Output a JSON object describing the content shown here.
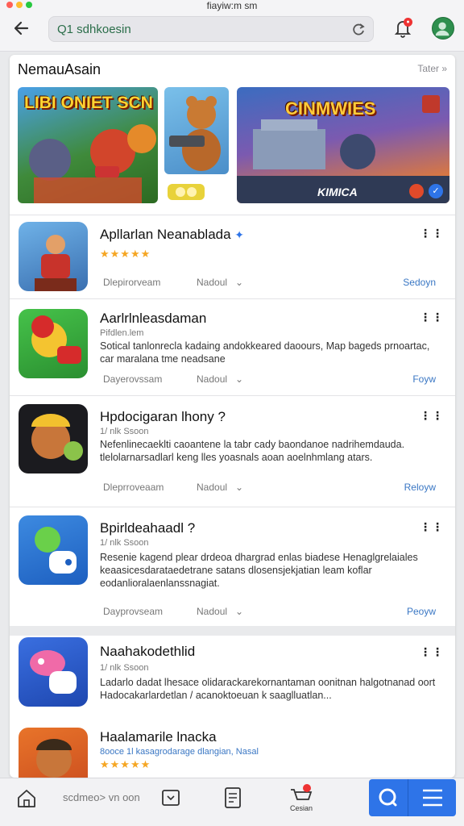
{
  "window": {
    "title": "fiayiw:m sm"
  },
  "search": {
    "value": "Q1 sdhkoesin"
  },
  "section": {
    "title": "NemauAsain",
    "see_all": "Tater »"
  },
  "banners": [
    {
      "text": "LIBI ONIET SCN",
      "tag": ""
    },
    {
      "text": "",
      "tag": ""
    },
    {
      "text": "CINMWIES",
      "tag": "KIMICA"
    }
  ],
  "apps": [
    {
      "name": "Apllarlan Neanablada",
      "stars": "★★★★★",
      "meta": "",
      "description": "",
      "left_label": "Dlepirorveam",
      "mid_label": "Nadoul",
      "action": "Sedoyn"
    },
    {
      "name": "Aarlrlnleasdaman",
      "stars": "",
      "meta": "Pifdlen.lem",
      "description": "Sotical tanlonrecla kadaing andokkeared daoours, Map bageds prnoartac, car maralana tme neadsane",
      "left_label": "Dayerovssam",
      "mid_label": "Nadoul",
      "action": "Foyw"
    },
    {
      "name": "Hpdocigaran lhony ?",
      "stars": "",
      "meta": "1/ nlk Ssoon",
      "description": "Nefenlinecaeklti caoantene la tabr cady baondanoe nadrihemdauda. tlelolarnarsadlarl keng lles yoasnals aoan aoelnhmlang atars.",
      "left_label": "Dleprroveaam",
      "mid_label": "Nadoul",
      "action": "Reloyw"
    },
    {
      "name": "Bpirldeahaadl ?",
      "stars": "",
      "meta": "1/ nlk Ssoon",
      "description": "Resenie kagend plear drdeoa dhargrad enlas biadese Henaglgrelaiales keaasicesdarataedetrane satans dlosensjekjatian leam koflar eodanlioralaenlanssnagiat.",
      "left_label": "Dayprovseam",
      "mid_label": "Nadoul",
      "action": "Peoyw"
    },
    {
      "name": "Naahakodethlid",
      "stars": "",
      "meta": "1/ nlk Ssoon",
      "description": "Ladarlo dadat lhesace olidarackarekornantaman oonitnan halgotnanad oort Hadocakarlardetlan / acanoktoeuan k saaglluatlan...",
      "left_label": "",
      "mid_label": "",
      "action": ""
    },
    {
      "name": "Haalamarile lnacka",
      "stars": "★★★★★",
      "meta": "8ooce 1l kasagrodarage dlangian, Nasal",
      "description": "",
      "left_label": "",
      "mid_label": "",
      "action": ""
    }
  ],
  "bottom": {
    "arrows_label": "scdmeo> vn oon",
    "cart_label": "Cesian"
  },
  "colors": {
    "accent": "#2e74e8",
    "link": "#3a77c4",
    "star": "#f5a623",
    "badge": "#e33333"
  }
}
